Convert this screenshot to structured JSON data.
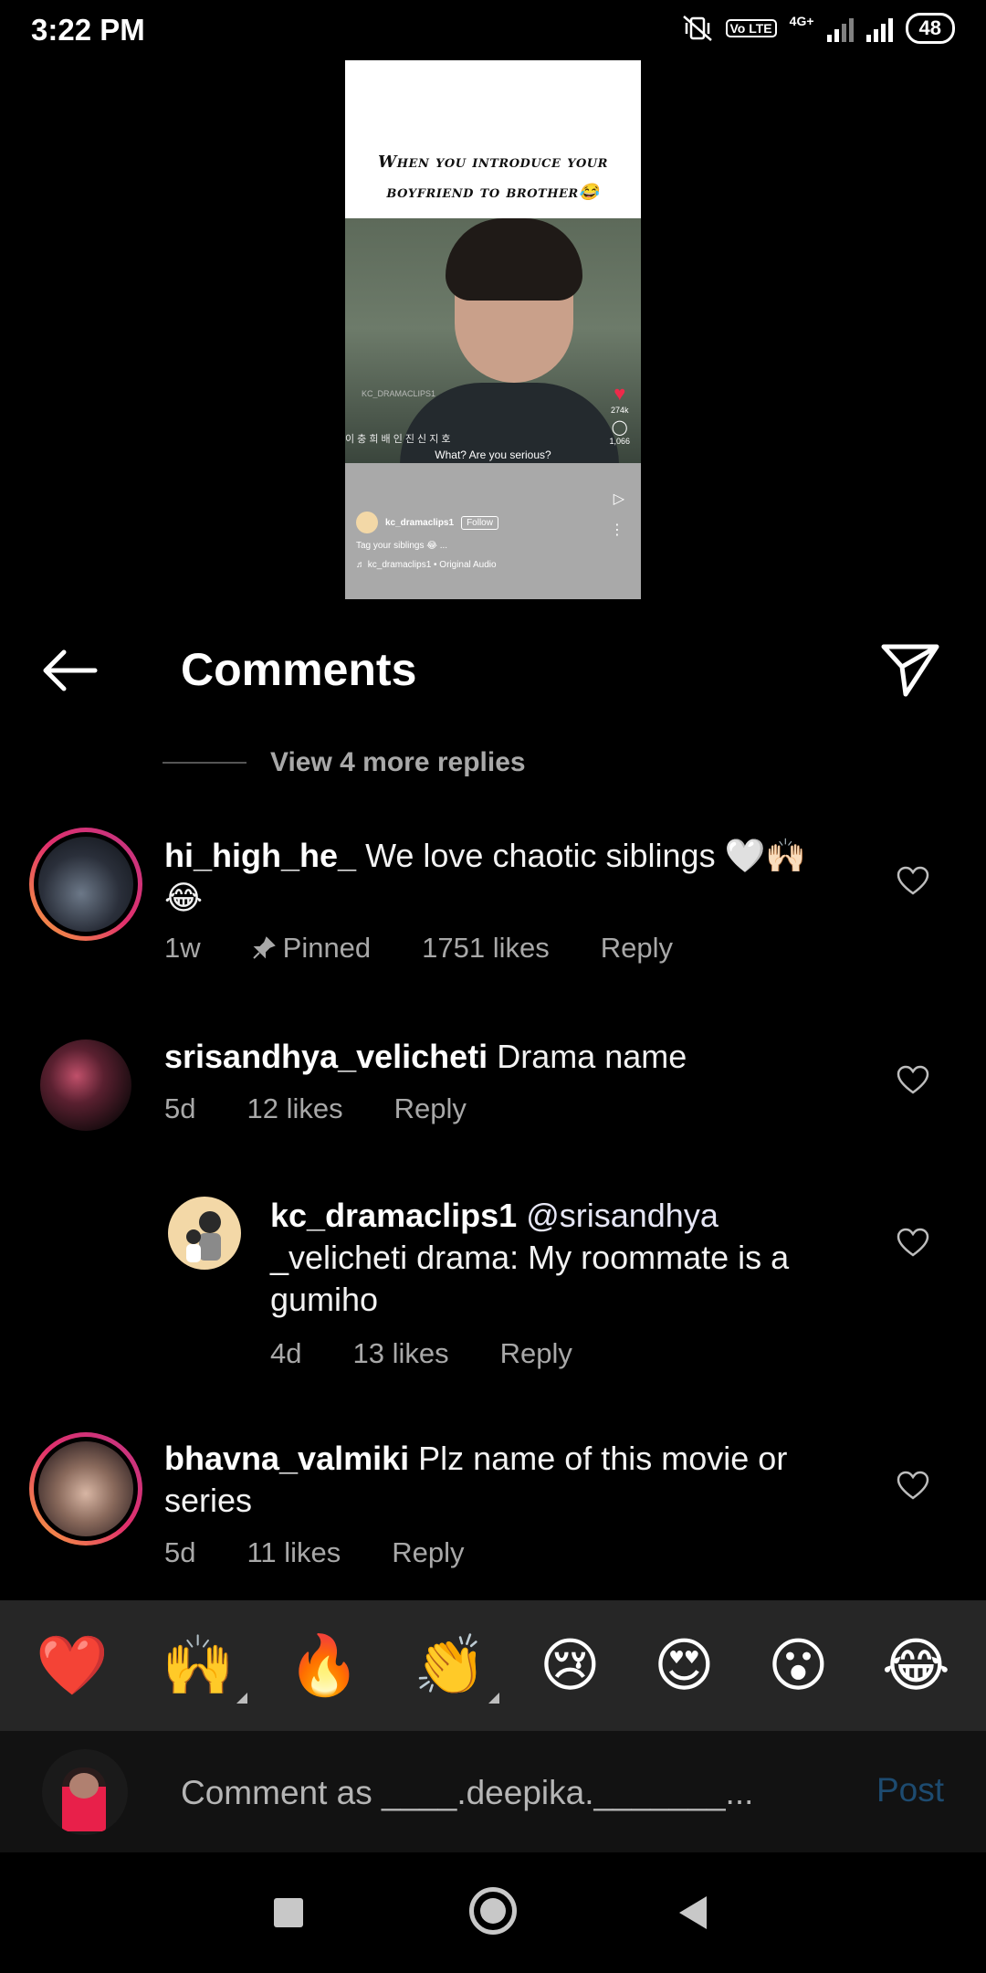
{
  "status_bar": {
    "time": "3:22 PM",
    "network": "4G+",
    "volte": "Vo LTE",
    "battery": "48"
  },
  "preview": {
    "caption_line1": "When you introduce your",
    "caption_line2": "boyfriend to brother😂",
    "watermark": "KC_DRAMACLIPS1",
    "korean_credits": "이 충 희   배 인 진   신 지 호",
    "subtitle": "What? Are you serious?",
    "likes": "274k",
    "comments_count": "1,066",
    "account": "kc_dramaclips1",
    "follow_label": "Follow",
    "post_caption": "Tag your siblings 😂 ...",
    "audio": "♬ kc_dramaclips1 • Original Audio"
  },
  "header": {
    "title": "Comments"
  },
  "view_more": "View 4 more replies",
  "comments": [
    {
      "username": "hi_high_he_",
      "text": "We love chaotic siblings 🤍🙌🏻",
      "text_line2": "😂",
      "time": "1w",
      "pinned_label": "Pinned",
      "likes": "1751 likes",
      "reply": "Reply"
    },
    {
      "username": "srisandhya_velicheti",
      "text": "Drama name",
      "time": "5d",
      "likes": "12 likes",
      "reply": "Reply"
    },
    {
      "username": "kc_dramaclips1",
      "mention": "@srisandhya",
      "line2": "_velicheti drama: My roommate is a",
      "line3": "gumiho",
      "time": "4d",
      "likes": "13 likes",
      "reply": "Reply"
    },
    {
      "username": "bhavna_valmiki",
      "text": "Plz name of this movie or",
      "text_line2": "series",
      "time": "5d",
      "likes": "11 likes",
      "reply": "Reply"
    }
  ],
  "emojis": [
    "❤️",
    "🙌",
    "🔥",
    "👏",
    "😢",
    "😍",
    "😮",
    "😂"
  ],
  "input": {
    "placeholder": "Comment as ____.deepika._______...",
    "post_label": "Post"
  },
  "colors": {
    "background": "#000000",
    "muted_text": "#a8a8a8",
    "emoji_bar": "#262626",
    "post_disabled": "#1d4b70",
    "story_ring_start": "#f9a83b",
    "story_ring_end": "#c13584"
  }
}
